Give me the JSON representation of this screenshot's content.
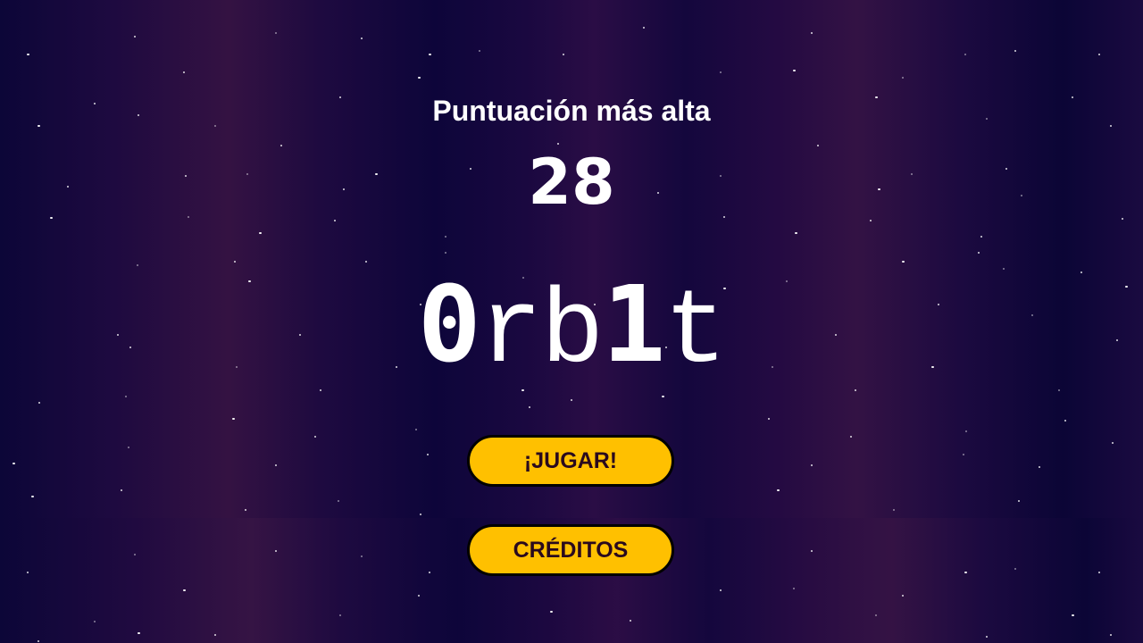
{
  "menu": {
    "highscore_label": "Puntuación más alta",
    "highscore_value": "28",
    "logo": {
      "part1": "0",
      "part2": "rb",
      "part3": "1",
      "part4": "t"
    },
    "play_label": "¡JUGAR!",
    "credits_label": "CRÉDITOS"
  },
  "colors": {
    "button_fill": "#ffc000",
    "button_text": "#2a0a1e",
    "button_border": "#000000",
    "text": "#ffffff",
    "background_dark": "#0c0638",
    "background_purple": "#341242"
  }
}
